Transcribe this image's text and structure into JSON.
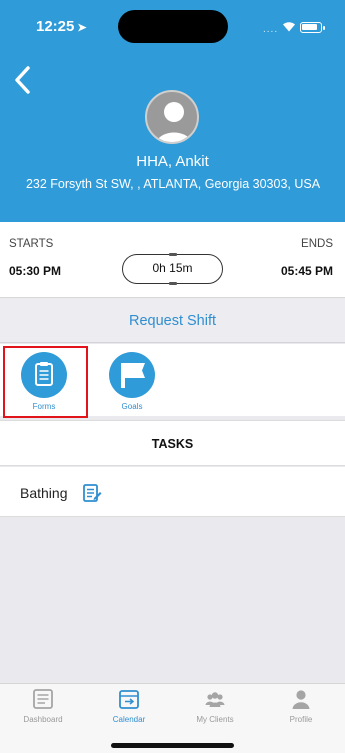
{
  "status_bar": {
    "time": "12:25",
    "signal": "...."
  },
  "header": {
    "name": "HHA, Ankit",
    "address": "232 Forsyth St SW, , ATLANTA, Georgia 30303, USA"
  },
  "shift": {
    "starts_label": "STARTS",
    "start_time": "05:30 PM",
    "ends_label": "ENDS",
    "end_time": "05:45 PM",
    "duration": "0h 15m"
  },
  "request_shift_label": "Request Shift",
  "actions": [
    {
      "label": "Forms",
      "icon": "clipboard-icon",
      "highlighted": true
    },
    {
      "label": "Goals",
      "icon": "flag-icon"
    }
  ],
  "tasks": {
    "header": "TASKS",
    "items": [
      {
        "label": "Bathing",
        "icon": "form-document-icon"
      }
    ]
  },
  "tabbar": {
    "tabs": [
      {
        "label": "Dashboard",
        "icon": "dashboard-icon",
        "active": false
      },
      {
        "label": "Calendar",
        "icon": "calendar-icon",
        "active": true
      },
      {
        "label": "My Clients",
        "icon": "clients-icon",
        "active": false
      },
      {
        "label": "Profile",
        "icon": "profile-icon",
        "active": false
      }
    ]
  },
  "colors": {
    "primary": "#2f9bd8",
    "link": "#2f8fd0",
    "highlight_border": "#e0141a"
  }
}
